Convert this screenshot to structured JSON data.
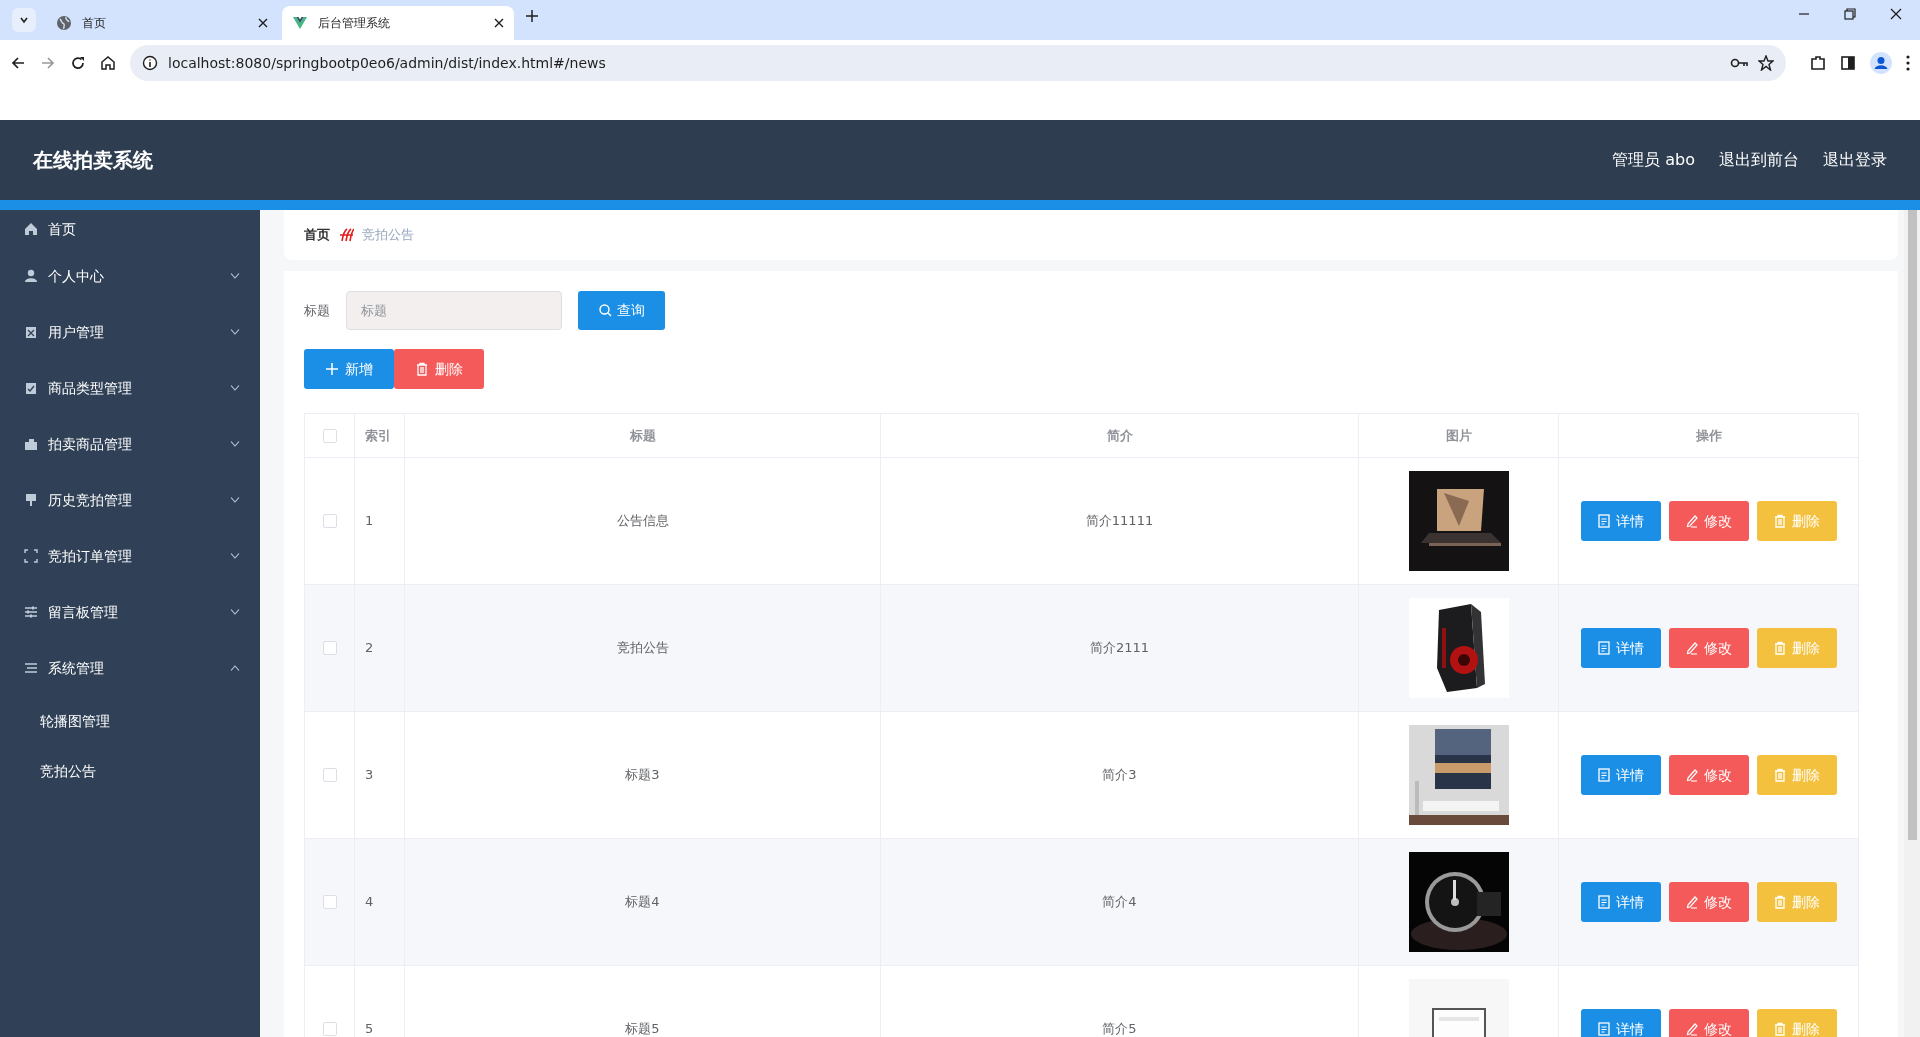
{
  "browser": {
    "tabs": [
      {
        "title": "首页",
        "selected": false
      },
      {
        "title": "后台管理系统",
        "selected": true
      }
    ],
    "url": "localhost:8080/springbootp0eo6/admin/dist/index.html#/news"
  },
  "header": {
    "title": "在线拍卖系统",
    "user": "管理员 abo",
    "links": [
      "退出到前台",
      "退出登录"
    ]
  },
  "sidebar": {
    "items": [
      {
        "label": "首页",
        "kind": "link"
      },
      {
        "label": "个人中心",
        "kind": "group",
        "expanded": false
      },
      {
        "label": "用户管理",
        "kind": "group",
        "expanded": false
      },
      {
        "label": "商品类型管理",
        "kind": "group",
        "expanded": false
      },
      {
        "label": "拍卖商品管理",
        "kind": "group",
        "expanded": false
      },
      {
        "label": "历史竞拍管理",
        "kind": "group",
        "expanded": false
      },
      {
        "label": "竞拍订单管理",
        "kind": "group",
        "expanded": false
      },
      {
        "label": "留言板管理",
        "kind": "group",
        "expanded": false
      },
      {
        "label": "系统管理",
        "kind": "group",
        "expanded": true,
        "children": [
          {
            "label": "轮播图管理"
          },
          {
            "label": "竞拍公告"
          }
        ]
      }
    ]
  },
  "breadcrumb": [
    "首页",
    "竞拍公告"
  ],
  "search": {
    "label": "标题",
    "placeholder": "标题",
    "button": "查询"
  },
  "actions": [
    {
      "label": "新增",
      "kind": "add"
    },
    {
      "label": "删除",
      "kind": "delete"
    }
  ],
  "table": {
    "columns": [
      "索引",
      "标题",
      "简介",
      "图片",
      "操作"
    ],
    "all_checked": false,
    "rows": [
      {
        "checked": false,
        "index": "1",
        "title": "公告信息",
        "summary": "简介11111",
        "buttons": [
          "详情",
          "修改",
          "删除"
        ]
      },
      {
        "checked": false,
        "index": "2",
        "title": "竞拍公告",
        "summary": "简介2111",
        "buttons": [
          "详情",
          "修改",
          "删除"
        ]
      },
      {
        "checked": false,
        "index": "3",
        "title": "标题3",
        "summary": "简介3",
        "buttons": [
          "详情",
          "修改",
          "删除"
        ]
      },
      {
        "checked": false,
        "index": "4",
        "title": "标题4",
        "summary": "简介4",
        "buttons": [
          "详情",
          "修改",
          "删除"
        ]
      },
      {
        "checked": false,
        "index": "5",
        "title": "标题5",
        "summary": "简介5",
        "buttons": [
          "详情",
          "修改",
          "删除"
        ]
      }
    ]
  }
}
